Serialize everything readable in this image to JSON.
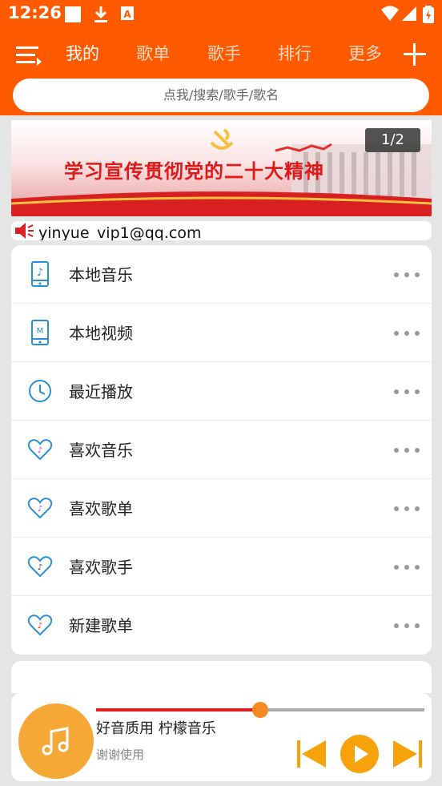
{
  "status": {
    "time": "12:26"
  },
  "header": {
    "tabs": [
      {
        "label": "我的",
        "active": true
      },
      {
        "label": "歌单",
        "active": false
      },
      {
        "label": "歌手",
        "active": false
      },
      {
        "label": "排行",
        "active": false
      },
      {
        "label": "更多",
        "active": false
      }
    ],
    "search_placeholder": "点我/搜索/歌手/歌名"
  },
  "banner": {
    "text": "学习宣传贯彻党的二十大精神",
    "counter": "1/2"
  },
  "notice": {
    "text": "yinyue_vip1@qq.com"
  },
  "menu": {
    "items": [
      {
        "label": "本地音乐",
        "icon": "phone-music-icon"
      },
      {
        "label": "本地视频",
        "icon": "phone-video-icon"
      },
      {
        "label": "最近播放",
        "icon": "clock-icon"
      },
      {
        "label": "喜欢音乐",
        "icon": "heart-icon"
      },
      {
        "label": "喜欢歌单",
        "icon": "heart-icon"
      },
      {
        "label": "喜欢歌手",
        "icon": "heart-icon"
      },
      {
        "label": "新建歌单",
        "icon": "heart-icon"
      }
    ]
  },
  "player": {
    "title": "好音质用 柠檬音乐",
    "subtitle": "谢谢使用",
    "progress": 0.5
  },
  "colors": {
    "accent": "#ff5a00",
    "icon_blue": "#2a8fd6",
    "player_orange": "#f6a836"
  }
}
